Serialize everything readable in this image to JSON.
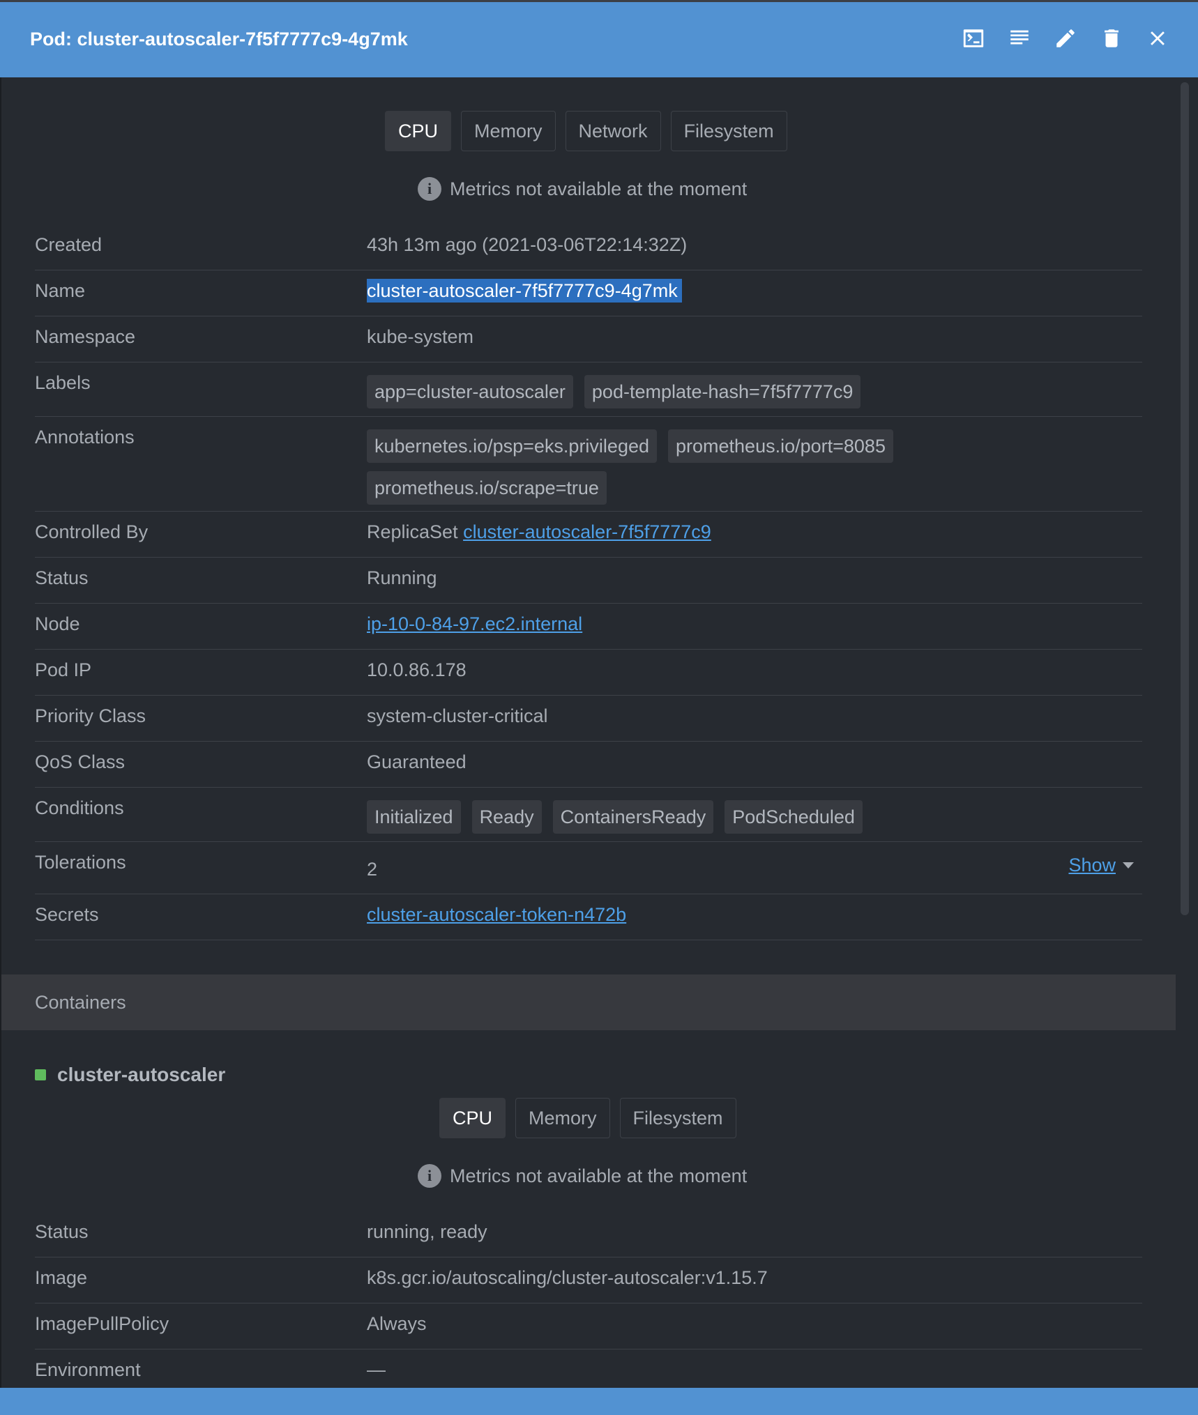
{
  "header": {
    "title": "Pod: cluster-autoscaler-7f5f7777c9-4g7mk",
    "icons": [
      "terminal-icon",
      "logs-icon",
      "edit-icon",
      "delete-icon",
      "close-icon"
    ]
  },
  "metrics_tabs": [
    "CPU",
    "Memory",
    "Network",
    "Filesystem"
  ],
  "metrics_notice": "Metrics not available at the moment",
  "details": {
    "created": {
      "label": "Created",
      "value": "43h 13m ago (2021-03-06T22:14:32Z)"
    },
    "name": {
      "label": "Name",
      "value": "cluster-autoscaler-7f5f7777c9-4g7mk"
    },
    "namespace": {
      "label": "Namespace",
      "value": "kube-system"
    },
    "labels": {
      "label": "Labels",
      "values": [
        "app=cluster-autoscaler",
        "pod-template-hash=7f5f7777c9"
      ]
    },
    "annotations": {
      "label": "Annotations",
      "values": [
        "kubernetes.io/psp=eks.privileged",
        "prometheus.io/port=8085",
        "prometheus.io/scrape=true"
      ]
    },
    "controlled_by": {
      "label": "Controlled By",
      "kind": "ReplicaSet",
      "link": "cluster-autoscaler-7f5f7777c9"
    },
    "status": {
      "label": "Status",
      "value": "Running"
    },
    "node": {
      "label": "Node",
      "value": "ip-10-0-84-97.ec2.internal"
    },
    "pod_ip": {
      "label": "Pod IP",
      "value": "10.0.86.178"
    },
    "priority_class": {
      "label": "Priority Class",
      "value": "system-cluster-critical"
    },
    "qos_class": {
      "label": "QoS Class",
      "value": "Guaranteed"
    },
    "conditions": {
      "label": "Conditions",
      "values": [
        "Initialized",
        "Ready",
        "ContainersReady",
        "PodScheduled"
      ]
    },
    "tolerations": {
      "label": "Tolerations",
      "value": "2",
      "toggle": "Show"
    },
    "secrets": {
      "label": "Secrets",
      "value": "cluster-autoscaler-token-n472b"
    }
  },
  "containers": {
    "section_title": "Containers",
    "name": "cluster-autoscaler",
    "status_color": "#5fbc5d",
    "metrics_tabs": [
      "CPU",
      "Memory",
      "Filesystem"
    ],
    "metrics_notice": "Metrics not available at the moment",
    "status": {
      "label": "Status",
      "value": "running, ready"
    },
    "image": {
      "label": "Image",
      "value": "k8s.gcr.io/autoscaling/cluster-autoscaler:v1.15.7"
    },
    "pull_policy": {
      "label": "ImagePullPolicy",
      "value": "Always"
    },
    "environment": {
      "label": "Environment",
      "value": "—"
    }
  },
  "colors": {
    "accent": "#5292d2",
    "background": "#262a30",
    "link": "#4ea0e8",
    "success": "#5fbc5d",
    "selection": "#2c6fbf"
  }
}
